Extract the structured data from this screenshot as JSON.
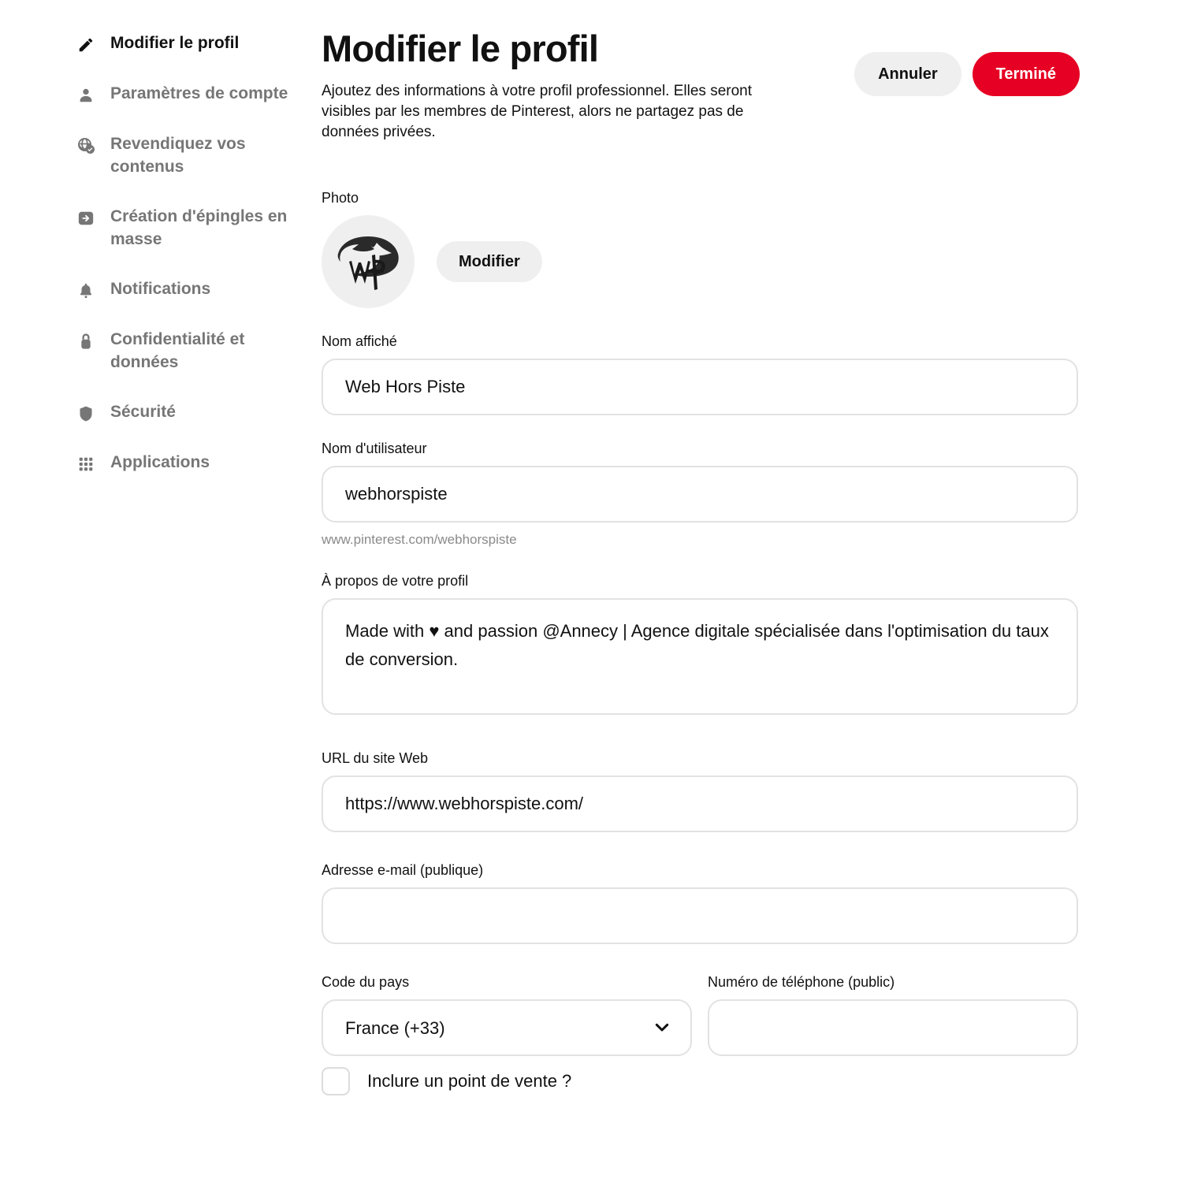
{
  "sidebar": {
    "items": [
      {
        "label": "Modifier le profil",
        "icon": "pencil-icon",
        "active": true
      },
      {
        "label": "Paramètres de compte",
        "icon": "person-icon",
        "active": false
      },
      {
        "label": "Revendiquez vos contenus",
        "icon": "globe-check-icon",
        "active": false
      },
      {
        "label": "Création d'épingles en masse",
        "icon": "import-arrow-icon",
        "active": false
      },
      {
        "label": "Notifications",
        "icon": "bell-icon",
        "active": false
      },
      {
        "label": "Confidentialité et données",
        "icon": "lock-icon",
        "active": false
      },
      {
        "label": "Sécurité",
        "icon": "shield-icon",
        "active": false
      },
      {
        "label": "Applications",
        "icon": "grid-icon",
        "active": false
      }
    ]
  },
  "header": {
    "title": "Modifier le profil",
    "description": "Ajoutez des informations à votre profil professionnel. Elles seront visibles par les membres de Pinterest, alors ne partagez pas de données privées.",
    "cancel_label": "Annuler",
    "done_label": "Terminé",
    "accent_color": "#e60023",
    "neutral_button_color": "#efefef"
  },
  "form": {
    "photo": {
      "label": "Photo",
      "change_label": "Modifier",
      "avatar_alt": "Web Hors Piste logo"
    },
    "display_name": {
      "label": "Nom affiché",
      "value": "Web Hors Piste",
      "placeholder": ""
    },
    "username": {
      "label": "Nom d'utilisateur",
      "value": "webhorspiste",
      "placeholder": "",
      "helper": "www.pinterest.com/webhorspiste"
    },
    "about": {
      "label": "À propos de votre profil",
      "value": "Made with ♥ and passion @Annecy | Agence digitale spécialisée dans l'optimisation du taux de conversion.",
      "placeholder": ""
    },
    "website": {
      "label": "URL du site Web",
      "value": "https://www.webhorspiste.com/",
      "placeholder": ""
    },
    "email": {
      "label": "Adresse e-mail (publique)",
      "value": "",
      "placeholder": ""
    },
    "country_code": {
      "label": "Code du pays",
      "value": "France (+33)",
      "options": [
        "France (+33)"
      ]
    },
    "phone": {
      "label": "Numéro de téléphone (public)",
      "value": "",
      "placeholder": ""
    },
    "point_of_sale": {
      "label": "Inclure un point de vente ?",
      "checked": false
    }
  }
}
